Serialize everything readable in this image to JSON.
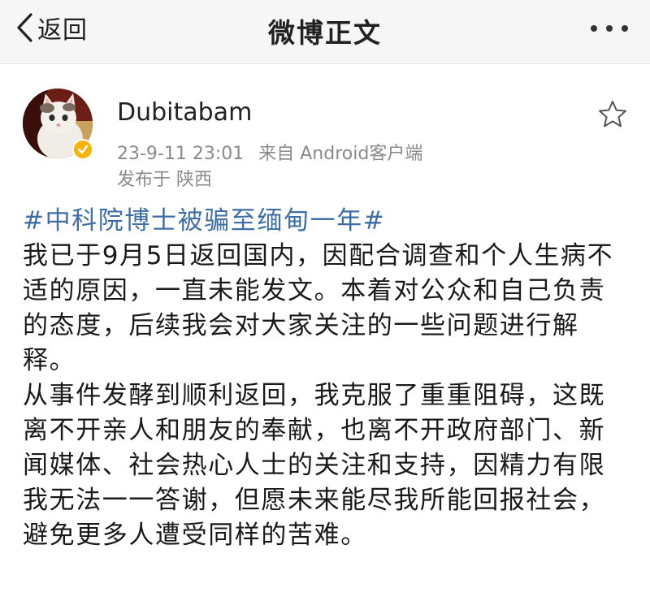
{
  "navbar": {
    "back_label": "返回",
    "title": "微博正文",
    "more_icon": "more-dots-icon"
  },
  "post": {
    "author": {
      "name": "Dubitabam",
      "avatar": "cat-avatar",
      "verified_badge_color": "#f5b400"
    },
    "time": "23-9-11 23:01",
    "source": "来自 Android客户端",
    "location": "发布于 陕西",
    "favorite_icon": "star-outline-icon",
    "hashtag": "#中科院博士被骗至缅甸一年#",
    "paragraphs": [
      "我已于9月5日返回国内，因配合调查和个人生病不适的原因，一直未能发文。本着对公众和自己负责的态度，后续我会对大家关注的一些问题进行解释。",
      "从事件发酵到顺利返回，我克服了重重阻碍，这既离不开亲人和朋友的奉献，也离不开政府部门、新闻媒体、社会热心人士的关注和支持，因精力有限我无法一一答谢，但愿未来能尽我所能回报社会，避免更多人遭受同样的苦难。"
    ]
  },
  "colors": {
    "hashtag": "#3d6ea8",
    "meta_text": "#8a8a8a",
    "navbar_bg": "#f6f6f6"
  }
}
